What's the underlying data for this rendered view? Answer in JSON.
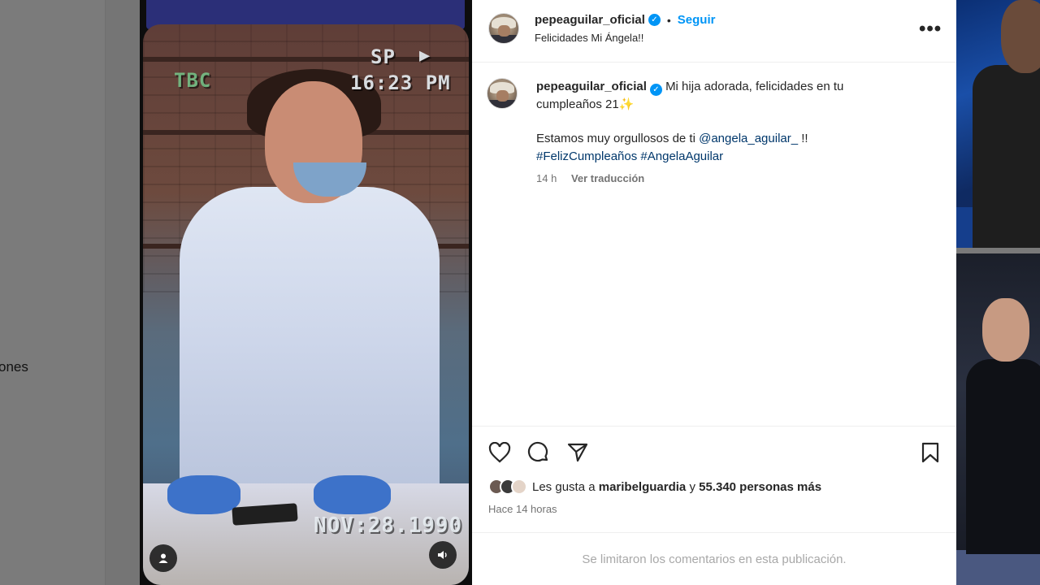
{
  "background": {
    "left_text": "ones"
  },
  "video": {
    "overlay_sp": "SP",
    "overlay_play": "▶",
    "overlay_tbc": "TBC",
    "overlay_time": "16:23 PM",
    "overlay_date": "NOV:28.1990",
    "user_icon": "user-icon",
    "sound_icon": "speaker-icon"
  },
  "post": {
    "header": {
      "username": "pepeaguilar_oficial",
      "separator": "•",
      "follow_label": "Seguir",
      "audio_text": "Felicidades Mi Ángela!!",
      "more_label": "•••"
    },
    "caption": {
      "username": "pepeaguilar_oficial",
      "line1": "Mi hija adorada, felicidades en tu cumpleaños 21",
      "emoji": "✨",
      "line2_prefix": "Estamos muy orgullosos de ti",
      "mention": "@angela_aguilar_",
      "line2_suffix": "!!",
      "hashtag1": "#FelizCumpleaños",
      "hashtag2": "#AngelaAguilar"
    },
    "meta": {
      "time": "14 h",
      "translate": "Ver traducción"
    },
    "actions": {
      "like_icon": "heart-icon",
      "comment_icon": "comment-icon",
      "share_icon": "send-icon",
      "save_icon": "bookmark-icon"
    },
    "likes": {
      "prefix": "Les gusta a",
      "user": "maribelguardia",
      "middle": "y",
      "count": "55.340 personas más"
    },
    "ago": "Hace 14 horas",
    "comments_limited": "Se limitaron los comentarios en esta publicación."
  },
  "colors": {
    "accent": "#0095f6",
    "link": "#00376b"
  }
}
